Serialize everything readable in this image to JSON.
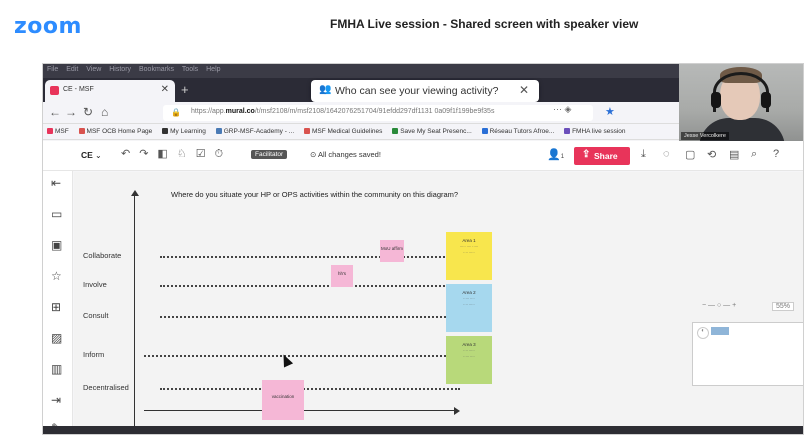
{
  "zoom": {
    "logo": "zoom",
    "title": "FMHA Live session - Shared screen with speaker view"
  },
  "browser": {
    "menu": [
      "File",
      "Edit",
      "View",
      "History",
      "Bookmarks",
      "Tools",
      "Help"
    ],
    "tab_title": "CE - MSF",
    "url_prefix": "https://app.",
    "url_domain": "mural.co",
    "url_rest": "/t/msf2108/m/msf2108/1642076251704/91efdd297df1131 0a09f1f199be9f35s",
    "bookmarks": [
      "MSF",
      "MSF OCB Home Page",
      "My Learning",
      "GRP-MSF-Academy - ...",
      "MSF Medical Guidelines",
      "Save My Seat Presenc...",
      "Réseau Tutors Afroe...",
      "FMHA live session"
    ],
    "bookmark_colors": [
      "#e8345a",
      "#d9534f",
      "#333333",
      "#4a7ab5",
      "#d9534f",
      "#2a8a3a",
      "#2a6fd6",
      "#6b4fbb"
    ]
  },
  "popup": {
    "text": "Who can see your viewing activity?"
  },
  "webcam": {
    "name": "Jesse Vercolkere"
  },
  "mural": {
    "board_name": "CE",
    "facilitator_label": "Facilitator",
    "saved_text": "All changes saved!",
    "share_label": "Share",
    "user_count": "1",
    "question": "Where do you situate your HP or OPS activities within the community on this diagram?",
    "rows": [
      "Collaborate",
      "Involve",
      "Consult",
      "Inform",
      "Decentralised"
    ],
    "stickies": {
      "pink_collab": "MoU affirm",
      "pink_involve": "hh's",
      "pink_decentral": "vaccination",
      "yellow_title": "Area 1",
      "blue_title": "Area 2",
      "green_title": "Area 3"
    },
    "zoom_pct": "55%"
  }
}
